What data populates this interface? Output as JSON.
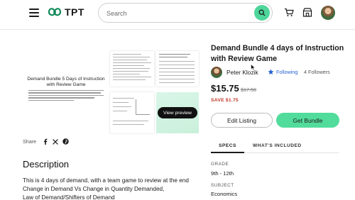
{
  "header": {
    "logo_text": "TPT",
    "search_placeholder": "Search"
  },
  "preview": {
    "main_title": "Demand Bundle 5 Days of Instruction with Review Game",
    "view_preview_label": "View preview"
  },
  "share": {
    "label": "Share"
  },
  "description": {
    "title": "Description",
    "lines": [
      "This is 4 days of demand, with a team game to review at the end",
      "Change in Demand Vs Change in Quantity Demanded,",
      "Law of Demand/Shifters of Demand"
    ]
  },
  "product": {
    "title": "Demand Bundle 4 days of Instruction with Review Game",
    "seller_name": "Peter Klozik",
    "following_label": "Following",
    "followers_count": "4 Followers",
    "price": "$15.75",
    "original_price": "$17.50",
    "save_text": "SAVE $1.75",
    "edit_listing_label": "Edit Listing",
    "get_bundle_label": "Get Bundle"
  },
  "tabs": [
    {
      "label": "SPECS"
    },
    {
      "label": "WHAT'S INCLUDED"
    }
  ],
  "specs": {
    "grade_label": "GRADE",
    "grade_value": "9th - 12th",
    "subject_label": "SUBJECT",
    "subject_value": "Economics"
  },
  "colors": {
    "brand_green": "#52dc9c",
    "follow_blue": "#2760d4",
    "save_red": "#c2392b"
  }
}
